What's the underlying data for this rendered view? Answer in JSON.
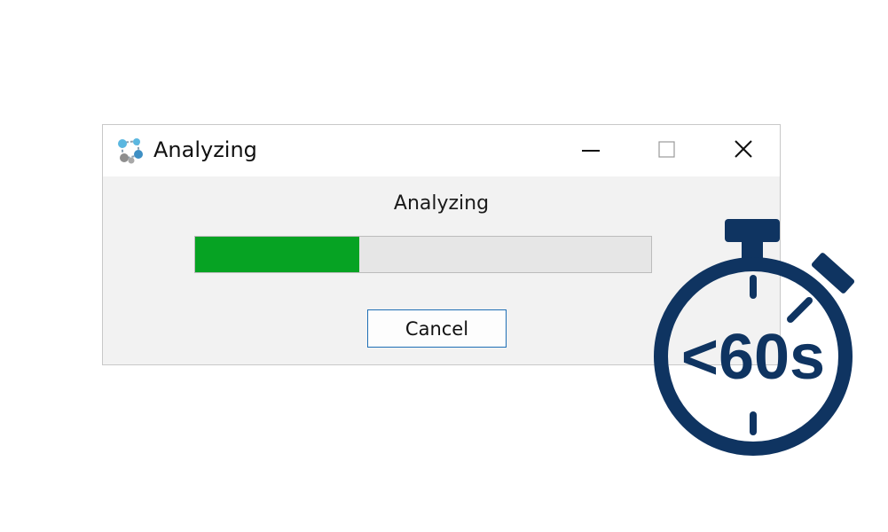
{
  "window": {
    "title": "Analyzing",
    "icon": "molecule-app-icon",
    "controls": [
      "minimize-icon",
      "maximize-icon",
      "close-icon"
    ]
  },
  "main": {
    "status_label": "Analyzing",
    "progress_percent": 36,
    "cancel_label": "Cancel"
  },
  "overlay": {
    "icon": "stopwatch-icon",
    "text": "<60s"
  },
  "colors": {
    "progress": "#06a323",
    "timer": "#0f3461",
    "button_border": "#1f6fb5"
  }
}
